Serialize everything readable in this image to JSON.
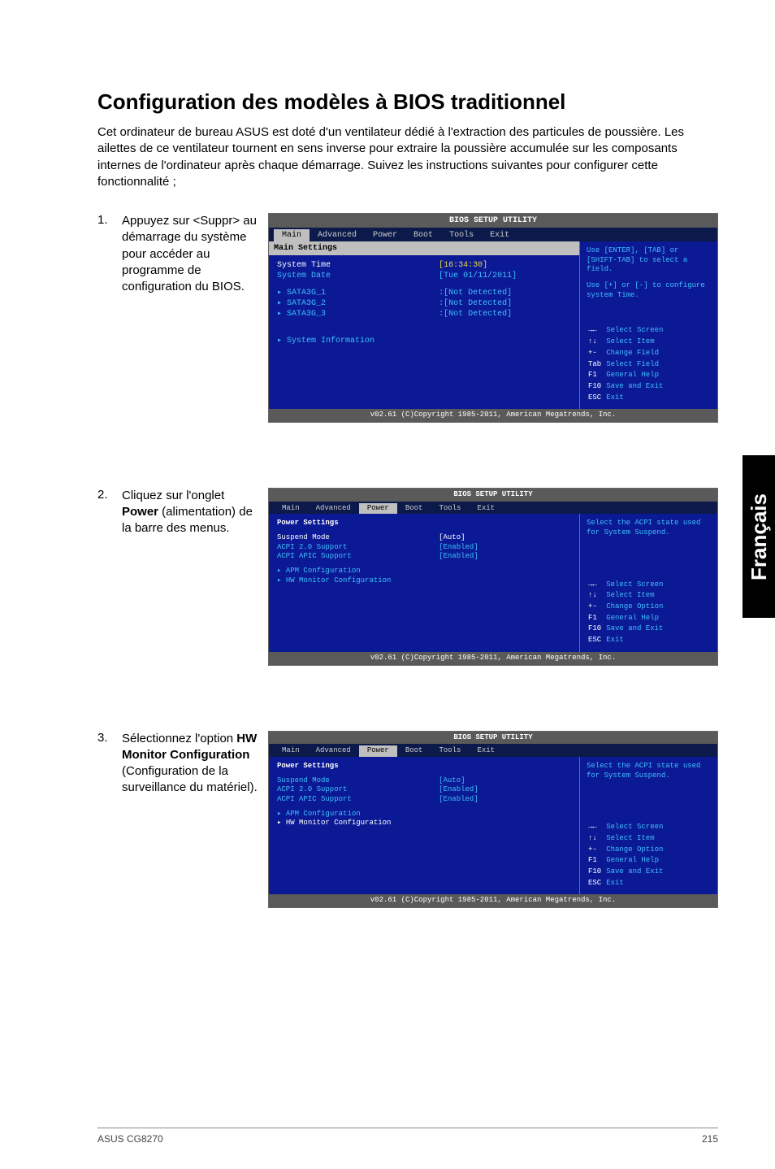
{
  "side_tab": "Français",
  "title": "Configuration des modèles à BIOS traditionnel",
  "intro": "Cet ordinateur de bureau ASUS est doté d'un ventilateur dédié à l'extraction des particules de poussière. Les ailettes de ce ventilateur tournent en sens inverse pour extraire la poussière accumulée sur les composants internes de l'ordinateur  après chaque démarrage. Suivez les instructions suivantes pour configurer cette fonctionnalité ;",
  "steps": {
    "s1": {
      "num": "1.",
      "text": "Appuyez sur <Suppr> au démarrage du système pour accéder au programme de configuration du BIOS."
    },
    "s2": {
      "num": "2.",
      "text_a": "Cliquez sur l'onglet ",
      "text_b": "Power",
      "text_c": " (alimentation) de la barre des menus."
    },
    "s3": {
      "num": "3.",
      "text_a": "Sélectionnez l'option ",
      "text_b": "HW Monitor Configuration",
      "text_c": " (Configuration de la surveillance du matériel)."
    }
  },
  "bios_common": {
    "title": "BIOS SETUP UTILITY",
    "tabs": [
      "Main",
      "Advanced",
      "Power",
      "Boot",
      "Tools",
      "Exit"
    ],
    "foot": "v02.61 (C)Copyright 1985-2011, American Megatrends, Inc."
  },
  "bios1": {
    "active_tab": 0,
    "section": "Main Settings",
    "rows": [
      {
        "lbl": "System Time",
        "val": "[16:34:30]",
        "lcls": "white",
        "vcls": "yellow",
        "sel": true
      },
      {
        "lbl": "System Date",
        "val": "[Tue 01/11/2011]",
        "lcls": "cyan",
        "vcls": "cyan"
      }
    ],
    "sata": [
      {
        "lbl": "SATA3G_1",
        "val": ":[Not Detected]"
      },
      {
        "lbl": "SATA3G_2",
        "val": ":[Not Detected]"
      },
      {
        "lbl": "SATA3G_3",
        "val": ":[Not Detected]"
      }
    ],
    "sysinfo": "System Information",
    "help_top": "Use [ENTER], [TAB] or [SHIFT-TAB] to select a field.",
    "help_mid": "Use [+] or [-] to configure system Time.",
    "keys": [
      {
        "k": "→←",
        "d": "Select Screen"
      },
      {
        "k": "↑↓",
        "d": "Select Item"
      },
      {
        "k": "+-",
        "d": "Change Field"
      },
      {
        "k": "Tab",
        "d": "Select Field"
      },
      {
        "k": "F1",
        "d": "General Help"
      },
      {
        "k": "F10",
        "d": "Save and Exit"
      },
      {
        "k": "ESC",
        "d": "Exit"
      }
    ]
  },
  "bios2": {
    "active_tab": 2,
    "section": "Power Settings",
    "rows": [
      {
        "lbl": "Suspend Mode",
        "val": "[Auto]",
        "lcls": "white",
        "vcls": "white",
        "sel": true
      },
      {
        "lbl": "ACPI 2.0 Support",
        "val": "[Enabled]",
        "lcls": "cyan",
        "vcls": "cyan"
      },
      {
        "lbl": "ACPI APIC Support",
        "val": "[Enabled]",
        "lcls": "cyan",
        "vcls": "cyan"
      }
    ],
    "subs": [
      {
        "lbl": "APM Configuration",
        "cls": "cyan"
      },
      {
        "lbl": "HW Monitor Configuration",
        "cls": "cyan"
      }
    ],
    "help_top": "Select the ACPI state used for System Suspend.",
    "keys": [
      {
        "k": "→←",
        "d": "Select Screen"
      },
      {
        "k": "↑↓",
        "d": "Select Item"
      },
      {
        "k": "+-",
        "d": "Change Option"
      },
      {
        "k": "F1",
        "d": "General Help"
      },
      {
        "k": "F10",
        "d": "Save and Exit"
      },
      {
        "k": "ESC",
        "d": "Exit"
      }
    ]
  },
  "bios3": {
    "active_tab": 2,
    "section": "Power Settings",
    "rows": [
      {
        "lbl": "Suspend Mode",
        "val": "[Auto]",
        "lcls": "cyan",
        "vcls": "cyan"
      },
      {
        "lbl": "ACPI 2.0 Support",
        "val": "[Enabled]",
        "lcls": "cyan",
        "vcls": "cyan"
      },
      {
        "lbl": "ACPI APIC Support",
        "val": "[Enabled]",
        "lcls": "cyan",
        "vcls": "cyan"
      }
    ],
    "subs": [
      {
        "lbl": "APM Configuration",
        "cls": "cyan"
      },
      {
        "lbl": "HW Monitor Configuration",
        "cls": "white",
        "sel": true
      }
    ],
    "help_top": "Select the ACPI state used for System Suspend.",
    "keys": [
      {
        "k": "→←",
        "d": "Select Screen"
      },
      {
        "k": "↑↓",
        "d": "Select Item"
      },
      {
        "k": "+-",
        "d": "Change Option"
      },
      {
        "k": "F1",
        "d": "General Help"
      },
      {
        "k": "F10",
        "d": "Save and Exit"
      },
      {
        "k": "ESC",
        "d": "Exit"
      }
    ]
  },
  "footer": {
    "left": "ASUS CG8270",
    "right": "215"
  }
}
